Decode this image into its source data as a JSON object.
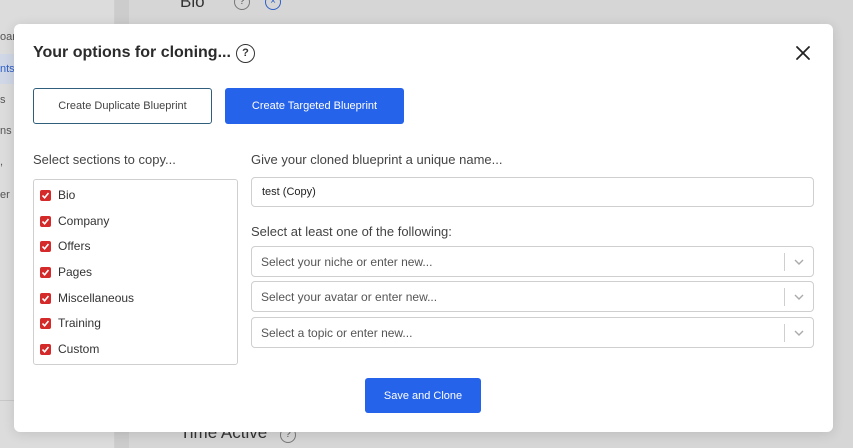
{
  "background": {
    "nav_items": [
      "oar",
      "nts",
      "s",
      "ns",
      ",",
      "er"
    ],
    "heading_top": "Bio",
    "heading_bottom": "Time Active",
    "help_glyph": "?",
    "close_glyph": "×"
  },
  "modal": {
    "title": "Your options for cloning...",
    "help_glyph": "?",
    "buttons": {
      "duplicate": "Create Duplicate Blueprint",
      "targeted": "Create Targeted Blueprint",
      "save": "Save and Clone"
    },
    "sections_label": "Select sections to copy...",
    "sections": [
      "Bio",
      "Company",
      "Offers",
      "Pages",
      "Miscellaneous",
      "Training",
      "Custom"
    ],
    "name_label": "Give your cloned blueprint a unique name...",
    "name_value": "test (Copy)",
    "select_label": "Select at least one of the following:",
    "selects": {
      "niche": "Select your niche or enter new...",
      "avatar": "Select your avatar or enter new...",
      "topic": "Select a topic or enter new..."
    }
  },
  "colors": {
    "primary": "#2563eb",
    "checkbox": "#d42a2a",
    "outline_border": "#2f5f7a"
  }
}
